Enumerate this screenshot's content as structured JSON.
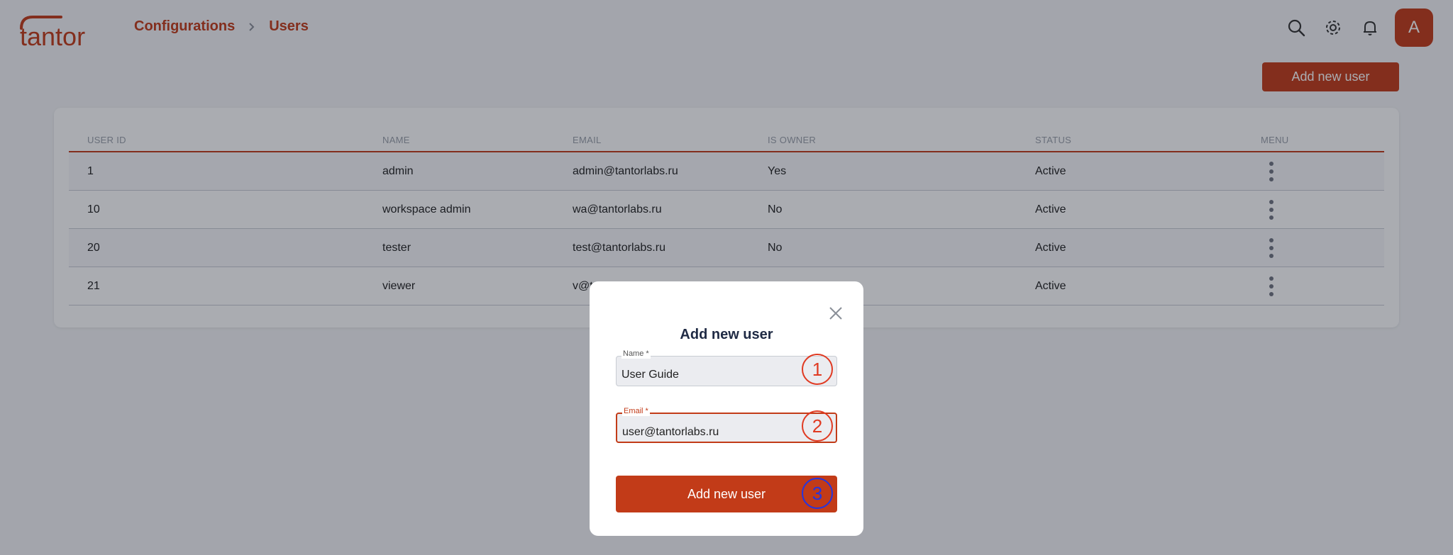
{
  "header": {
    "logo_text": "tantor",
    "breadcrumb": [
      "Configurations",
      "Users"
    ],
    "icons": [
      "search-icon",
      "gear-icon",
      "bell-icon"
    ],
    "avatar_initial": "A"
  },
  "toolbar": {
    "add_user_label": "Add new user"
  },
  "table": {
    "columns": [
      "USER ID",
      "NAME",
      "EMAIL",
      "IS OWNER",
      "STATUS",
      "MENU"
    ],
    "rows": [
      {
        "id": "1",
        "name": "admin",
        "email": "admin@tantorlabs.ru",
        "owner": "Yes",
        "status": "Active"
      },
      {
        "id": "10",
        "name": "workspace admin",
        "email": "wa@tantorlabs.ru",
        "owner": "No",
        "status": "Active"
      },
      {
        "id": "20",
        "name": "tester",
        "email": "test@tantorlabs.ru",
        "owner": "No",
        "status": "Active"
      },
      {
        "id": "21",
        "name": "viewer",
        "email": "v@t",
        "owner": "",
        "status": "Active"
      }
    ]
  },
  "modal": {
    "title": "Add new user",
    "name_label": "Name *",
    "name_value": "User Guide",
    "email_label": "Email *",
    "email_value": "user@tantorlabs.ru",
    "submit_label": "Add new user",
    "steps": [
      "1",
      "2",
      "3"
    ]
  },
  "colors": {
    "accent": "#c23b18",
    "step_red": "#e03a22",
    "step_blue": "#2435e0"
  }
}
